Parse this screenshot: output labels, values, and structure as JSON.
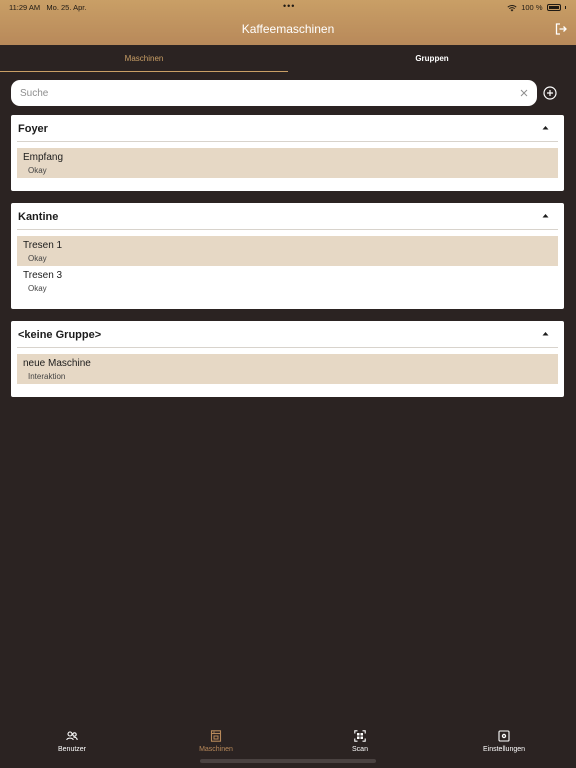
{
  "status_bar": {
    "time": "11:29 AM",
    "date": "Mo. 25. Apr.",
    "dots": "•••",
    "battery": "100 %"
  },
  "header": {
    "title": "Kaffeemaschinen",
    "logout_icon": "logout-icon"
  },
  "tabs": [
    {
      "label": "Maschinen",
      "active": true
    },
    {
      "label": "Gruppen",
      "active": false
    }
  ],
  "search": {
    "placeholder": "Suche",
    "value": ""
  },
  "groups": [
    {
      "title": "Foyer",
      "machines": [
        {
          "name": "Empfang",
          "status": "Okay",
          "highlight": true
        }
      ]
    },
    {
      "title": "Kantine",
      "machines": [
        {
          "name": "Tresen 1",
          "status": "Okay",
          "highlight": true
        },
        {
          "name": "Tresen 3",
          "status": "Okay",
          "highlight": false
        }
      ]
    },
    {
      "title": "<keine Gruppe>",
      "machines": [
        {
          "name": "neue Maschine",
          "status": "Interaktion",
          "highlight": true
        }
      ]
    }
  ],
  "bottom_nav": [
    {
      "label": "Benutzer",
      "icon": "users-icon",
      "active": false
    },
    {
      "label": "Maschinen",
      "icon": "coffee-machine-icon",
      "active": true
    },
    {
      "label": "Scan",
      "icon": "qr-scan-icon",
      "active": false
    },
    {
      "label": "Einstellungen",
      "icon": "settings-icon",
      "active": false
    }
  ],
  "colors": {
    "accent": "#c99f66",
    "background": "#2b2322",
    "highlight_row": "#e6d8c5"
  }
}
